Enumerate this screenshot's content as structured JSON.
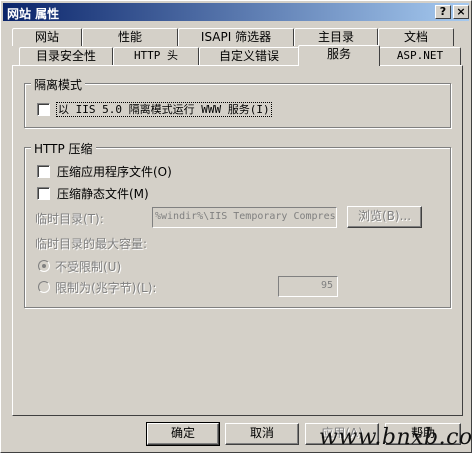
{
  "window": {
    "title": "网站 属性",
    "help_btn": "?",
    "close_btn": "×"
  },
  "tabs": {
    "row1": [
      "网站",
      "性能",
      "ISAPI 筛选器",
      "主目录",
      "文档"
    ],
    "row2": [
      "目录安全性",
      "HTTP 头",
      "自定义错误",
      "服务",
      "ASP.NET"
    ],
    "active": "服务"
  },
  "isolation": {
    "title": "隔离模式",
    "iis5_label": "以 IIS 5.0 隔离模式运行 WWW 服务(I)"
  },
  "compression": {
    "title": "HTTP 压缩",
    "app_files_label": "压缩应用程序文件(O)",
    "static_files_label": "压缩静态文件(M)",
    "temp_dir_label": "临时目录(T):",
    "temp_dir_value": "%windir%\\IIS Temporary Compres",
    "browse_label": "浏览(B)...",
    "max_size_label": "临时目录的最大容量:",
    "unlimited_label": "不受限制(U)",
    "limit_label": "限制为(兆字节)(L):",
    "limit_value": "95"
  },
  "footer": {
    "ok_label": "确定",
    "cancel_label": "取消",
    "apply_label": "应用(A)",
    "help_label": "帮助"
  },
  "watermark": "www.bnxb.com"
}
